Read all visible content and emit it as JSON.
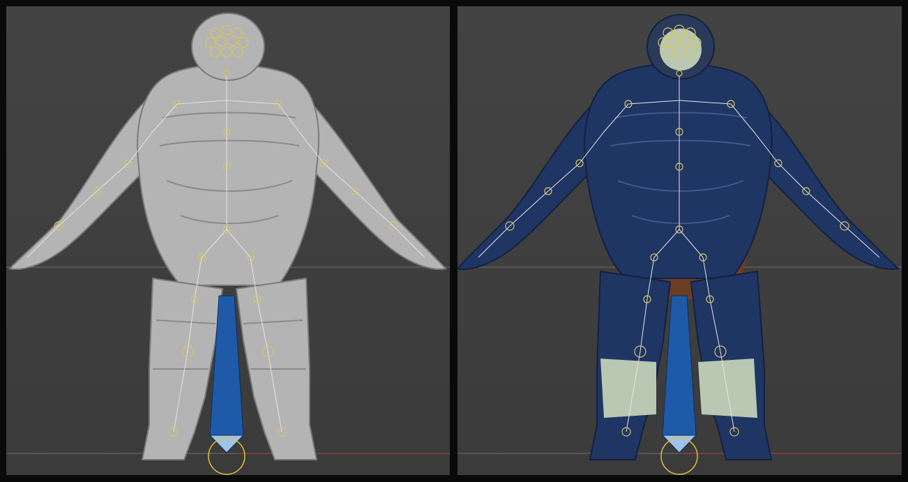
{
  "viewports": [
    {
      "shading": "untextured-grey",
      "body_color": "#b4b4b4",
      "shade_color": "#7a7a7a"
    },
    {
      "shading": "textured",
      "body_color": "#1f3563",
      "shade_color": "#14213f",
      "accent_color": "#6a3e22",
      "boot_color": "#b9c8b2"
    }
  ],
  "colors": {
    "background": "#404040",
    "horizon_line": "#6e6e6e",
    "ground_line": "#b04040",
    "bone_line": "#e6e6e6",
    "joint": "#d8c560",
    "root_bone": "#1f5aa8"
  }
}
